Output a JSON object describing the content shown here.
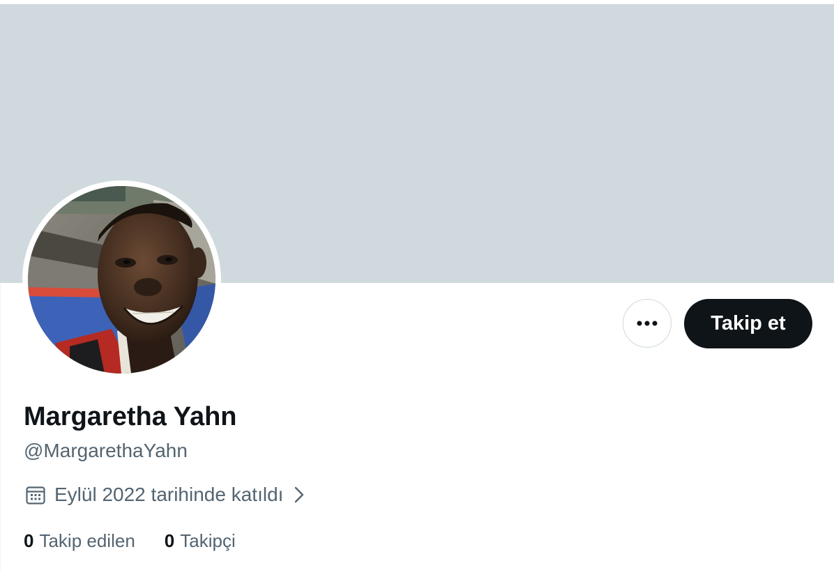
{
  "profile": {
    "display_name": "Margaretha Yahn",
    "handle": "@MargarethaYahn",
    "joined_text": "Eylül 2022 tarihinde katıldı",
    "avatar_description": "profile-photo"
  },
  "actions": {
    "more_icon": "ellipsis-icon",
    "follow_label": "Takip et"
  },
  "stats": {
    "following_count": "0",
    "following_label": "Takip edilen",
    "followers_count": "0",
    "followers_label": "Takipçi"
  },
  "colors": {
    "banner": "#cfd9de",
    "primary_text": "#0f1419",
    "secondary_text": "#536471",
    "follow_button_bg": "#0f1419",
    "follow_button_text": "#ffffff"
  },
  "icons": {
    "calendar": "calendar-icon",
    "chevron": "chevron-right-icon"
  }
}
